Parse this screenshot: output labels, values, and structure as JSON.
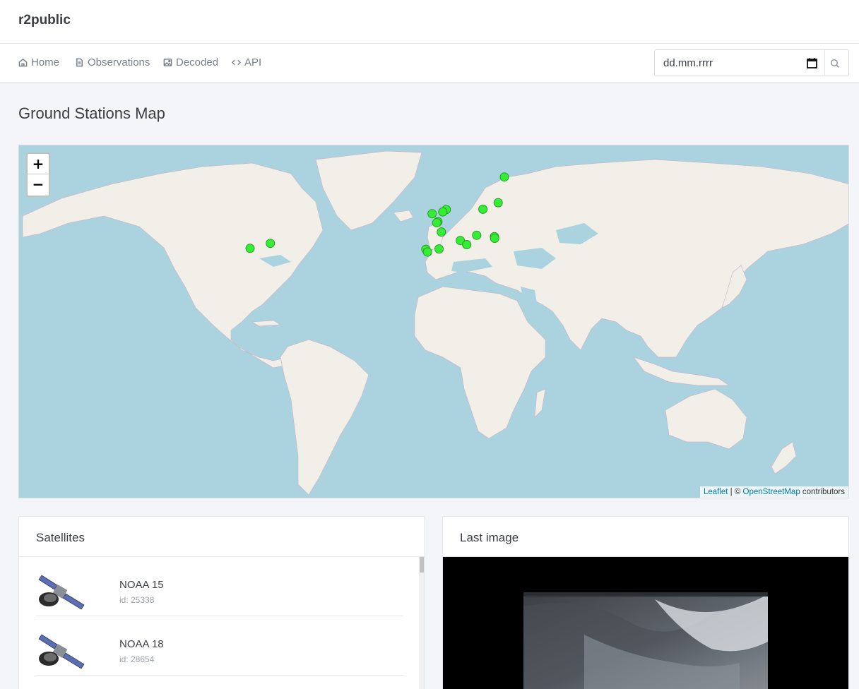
{
  "app": {
    "brand": "r2public"
  },
  "nav": {
    "items": [
      {
        "label": "Home",
        "icon": "home-icon"
      },
      {
        "label": "Observations",
        "icon": "document-icon"
      },
      {
        "label": "Decoded",
        "icon": "image-icon"
      },
      {
        "label": "API",
        "icon": "code-icon"
      }
    ],
    "date_placeholder": "dd.mm.rrrr"
  },
  "page": {
    "title": "Ground Stations Map"
  },
  "map": {
    "zoom_in": "+",
    "zoom_out": "−",
    "attribution": {
      "leaflet": "Leaflet",
      "separator": " | © ",
      "osm": "OpenStreetMap",
      "suffix": " contributors"
    },
    "marker_color": "#33ee33",
    "stations": [
      {
        "lat": 59.9,
        "lon": 30.3
      },
      {
        "lat": 53.9,
        "lon": 27.6
      },
      {
        "lat": 52.2,
        "lon": 21.0
      },
      {
        "lat": 52.1,
        "lon": 5.1
      },
      {
        "lat": 51.5,
        "lon": 3.6
      },
      {
        "lat": 51.0,
        "lon": -1.0
      },
      {
        "lat": 48.8,
        "lon": 1.5
      },
      {
        "lat": 48.5,
        "lon": 1.0
      },
      {
        "lat": 45.8,
        "lon": 3.0
      },
      {
        "lat": 44.8,
        "lon": 18.3
      },
      {
        "lat": 44.4,
        "lon": 26.0
      },
      {
        "lat": 43.9,
        "lon": 26.1
      },
      {
        "lat": 43.2,
        "lon": 11.2
      },
      {
        "lat": 41.9,
        "lon": 14.0
      },
      {
        "lat": 40.4,
        "lon": -3.7
      },
      {
        "lat": 39.5,
        "lon": -3.0
      },
      {
        "lat": 40.5,
        "lon": 2.0
      },
      {
        "lat": 42.3,
        "lon": -71.1
      },
      {
        "lat": 40.7,
        "lon": -79.9
      }
    ]
  },
  "satellites": {
    "title": "Satellites",
    "items": [
      {
        "name": "NOAA 15",
        "id": "id: 25338"
      },
      {
        "name": "NOAA 18",
        "id": "id: 28654"
      }
    ]
  },
  "last_image": {
    "title": "Last image"
  }
}
